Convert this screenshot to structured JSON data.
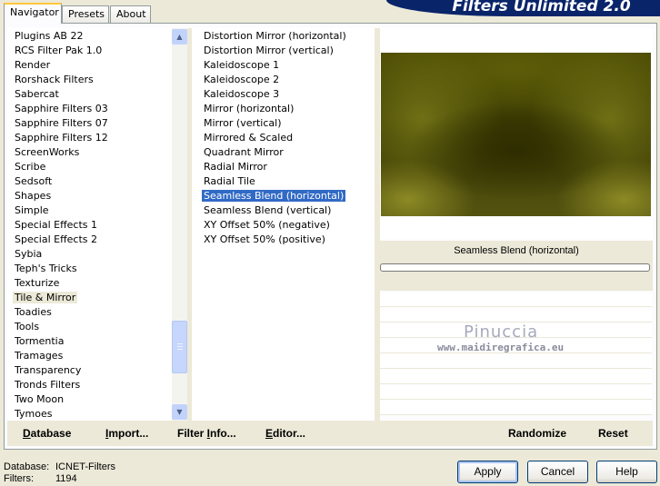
{
  "tabs": [
    {
      "label": "Navigator",
      "active": true
    },
    {
      "label": "Presets",
      "active": false
    },
    {
      "label": "About",
      "active": false
    }
  ],
  "banner": {
    "title": "Filters Unlimited 2.0",
    "color": "#0a246a"
  },
  "categories": {
    "items": [
      "Plugins AB 22",
      "RCS Filter Pak 1.0",
      "Render",
      "Rorshack Filters",
      "Sabercat",
      "Sapphire Filters 03",
      "Sapphire Filters 07",
      "Sapphire Filters 12",
      "ScreenWorks",
      "Scribe",
      "Sedsoft",
      "Shapes",
      "Simple",
      "Special Effects 1",
      "Special Effects 2",
      "Sybia",
      "Teph's Tricks",
      "Texturize",
      "Tile & Mirror",
      "Toadies",
      "Tools",
      "Tormentia",
      "Tramages",
      "Transparency",
      "Tronds Filters",
      "Two Moon",
      "Tymoes"
    ],
    "selected": "Tile & Mirror"
  },
  "filters": {
    "items": [
      "Distortion Mirror (horizontal)",
      "Distortion Mirror (vertical)",
      "Kaleidoscope 1",
      "Kaleidoscope 2",
      "Kaleidoscope 3",
      "Mirror (horizontal)",
      "Mirror (vertical)",
      "Mirrored & Scaled",
      "Quadrant Mirror",
      "Radial Mirror",
      "Radial Tile",
      "Seamless Blend (horizontal)",
      "Seamless Blend (vertical)",
      "XY Offset 50% (negative)",
      "XY Offset 50% (positive)"
    ],
    "selected": "Seamless Blend (horizontal)",
    "highlight_color": "#316ac5"
  },
  "preview": {
    "filter_name": "Seamless Blend (horizontal)"
  },
  "watermark": {
    "name": "Pinuccia",
    "site": "www.maidiregrafica.eu"
  },
  "toolbar": {
    "database": {
      "first": "D",
      "rest": "atabase"
    },
    "import": {
      "first": "I",
      "rest": "mport..."
    },
    "filter_info": {
      "pre": "Filter ",
      "first": "I",
      "rest": "nfo..."
    },
    "editor": {
      "first": "E",
      "rest": "ditor..."
    },
    "randomize": "Randomize",
    "reset": "Reset"
  },
  "status": {
    "database_label": "Database:",
    "database_value": "ICNET-Filters",
    "filters_label": "Filters:",
    "filters_value": "1194"
  },
  "buttons": {
    "apply": "Apply",
    "cancel": "Cancel",
    "help": "Help"
  }
}
